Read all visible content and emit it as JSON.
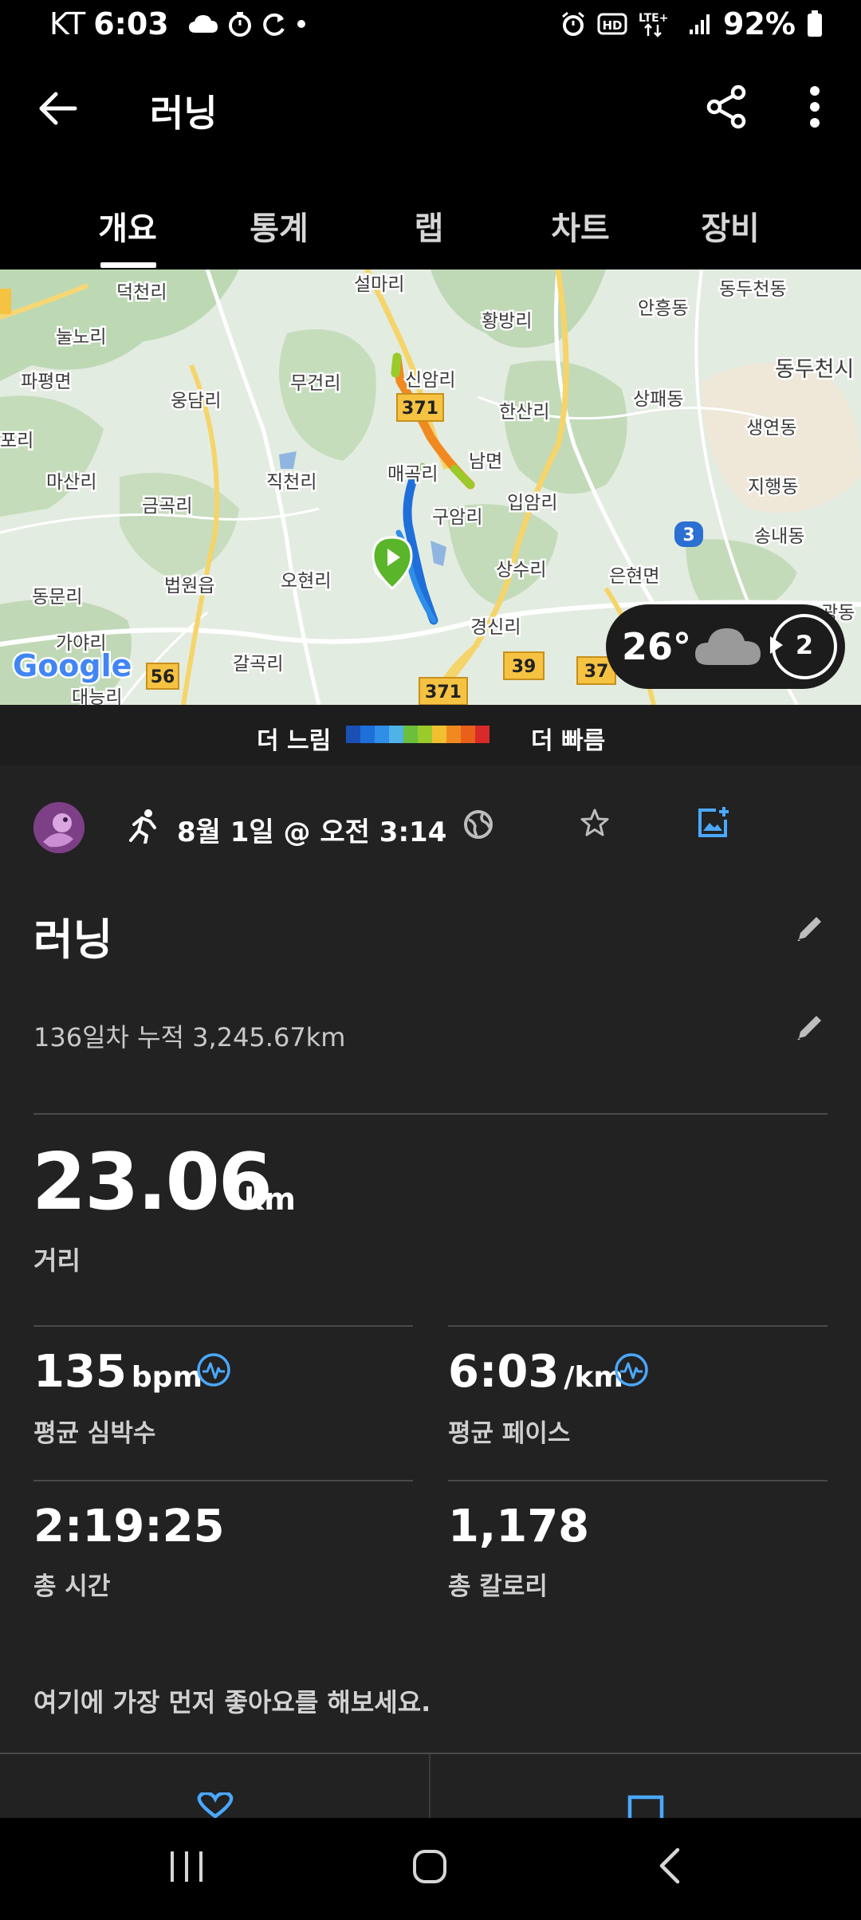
{
  "status_bar": {
    "carrier": "KT",
    "time": "6:03",
    "network": "LTE+",
    "battery": "92%"
  },
  "app_bar": {
    "title": "러닝",
    "back_icon": "arrow-left-icon",
    "share_icon": "share-icon",
    "more_icon": "more-vert-icon"
  },
  "tabs": [
    {
      "label": "개요",
      "active": true
    },
    {
      "label": "통계",
      "active": false
    },
    {
      "label": "랩",
      "active": false
    },
    {
      "label": "차트",
      "active": false
    },
    {
      "label": "장비",
      "active": false
    }
  ],
  "map": {
    "place_labels": [
      "덕천리",
      "설마리",
      "황방리",
      "안흥동",
      "동두천동",
      "눌노리",
      "파평면",
      "동두천시",
      "신암리",
      "무건리",
      "웅담리",
      "상패동",
      "한산리",
      "생연동",
      "포리",
      "매곡리",
      "남면",
      "마산리",
      "직천리",
      "지행동",
      "금곡리",
      "입암리",
      "구암리",
      "송내동",
      "법원읍",
      "오현리",
      "상수리",
      "은현면",
      "동문리",
      "경신리",
      "가야리",
      "갈곡리",
      "대능리",
      "광동"
    ],
    "road_badges": [
      "371",
      "3",
      "37",
      "56",
      "39",
      "371"
    ],
    "attribution": "Google"
  },
  "weather": {
    "temperature": "26°",
    "condition_icon": "cloud-icon",
    "wind": "2"
  },
  "pace_legend": {
    "slow_label": "더 느림",
    "fast_label": "더 빠름",
    "colors": [
      "#1a4fb4",
      "#1e6fd9",
      "#2e8ee8",
      "#4fb3e8",
      "#6bbf3a",
      "#9acb2a",
      "#f0c030",
      "#f08a20",
      "#e8601a",
      "#d82a2a"
    ]
  },
  "activity": {
    "date": "8월 1일 @ 오전 3:14",
    "title": "러닝",
    "description": "136일차 누적 3,245.67km"
  },
  "distance": {
    "value": "23.06",
    "unit": "km",
    "label": "거리"
  },
  "stats": {
    "heart_rate": {
      "value": "135",
      "unit": "bpm",
      "label": "평균 심박수"
    },
    "pace": {
      "value": "6:03",
      "unit": "/km",
      "label": "평균 페이스"
    },
    "time": {
      "value": "2:19:25",
      "label": "총 시간"
    },
    "calories": {
      "value": "1,178",
      "label": "총 칼로리"
    }
  },
  "social": {
    "like_prompt": "여기에 가장 먼저 좋아요를 해보세요."
  },
  "colors": {
    "accent_blue": "#4aa8ff",
    "background": "#222222",
    "route_start": "#5ab52a"
  }
}
